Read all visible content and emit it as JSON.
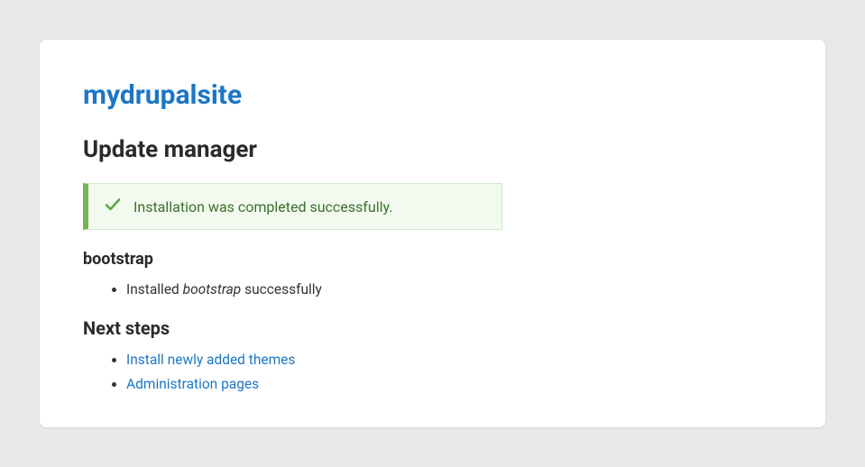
{
  "site_title": "mydrupalsite",
  "page_heading": "Update manager",
  "status": {
    "message": "Installation was completed successfully."
  },
  "install_result": {
    "module_name": "bootstrap",
    "item_prefix": "Installed ",
    "item_module": "bootstrap",
    "item_suffix": " successfully"
  },
  "next_steps": {
    "heading": "Next steps",
    "links": [
      "Install newly added themes",
      "Administration pages"
    ]
  }
}
